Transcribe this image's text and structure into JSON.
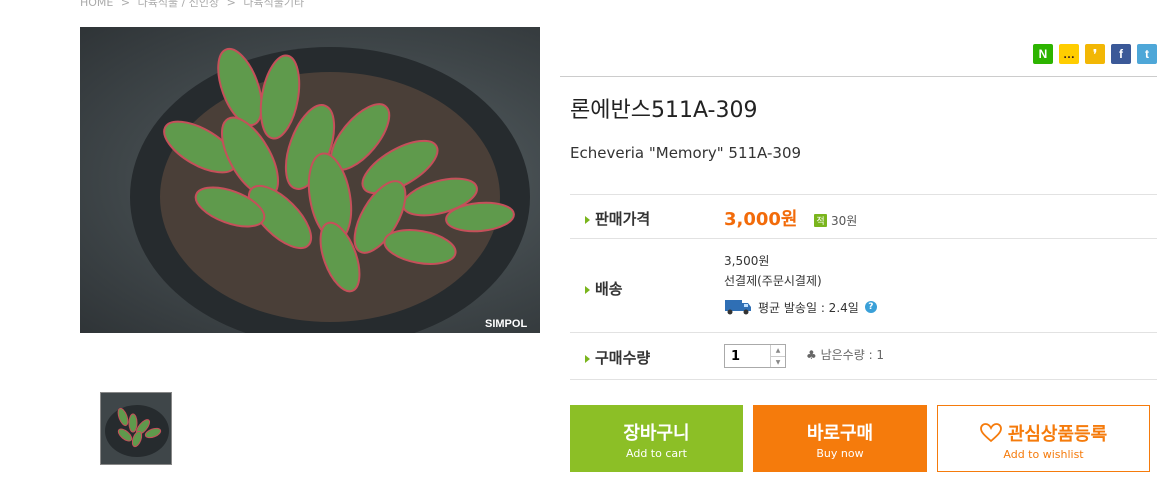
{
  "breadcrumb": [
    "HOME",
    ">",
    "다육식물 / 선인장",
    ">",
    "다육식물기타"
  ],
  "share_icons": [
    "naver-icon",
    "kakaotalk-icon",
    "kakaostory-icon",
    "facebook-icon",
    "twitter-icon"
  ],
  "share_labels": [
    "N",
    "…",
    "❜",
    "f",
    "t"
  ],
  "watermark": "SIMPOL",
  "product": {
    "title": "론에반스511A-309",
    "subtitle": "Echeveria \"Memory\" 511A-309"
  },
  "rows": {
    "price_label": "판매가격",
    "price": "3,000원",
    "point_badge": "적",
    "point": "30원",
    "shipping_label": "배송",
    "shipping_fee": "3,500원",
    "shipping_method": "선결제(주문시결제)",
    "avg_ship": "평균 발송일 : 2.4일",
    "qty_label": "구매수량",
    "qty_value": "1",
    "remaining": "남은수량 : 1"
  },
  "buttons": {
    "cart": "장바구니",
    "cart_sub": "Add to cart",
    "buy": "바로구매",
    "buy_sub": "Buy now",
    "wish": "관심상품등록",
    "wish_sub": "Add to wishlist"
  },
  "colors": {
    "price": "#f26b0a",
    "cart": "#8cbf26",
    "buy": "#f57b0c",
    "accent_arrow": "#7ab51d"
  }
}
